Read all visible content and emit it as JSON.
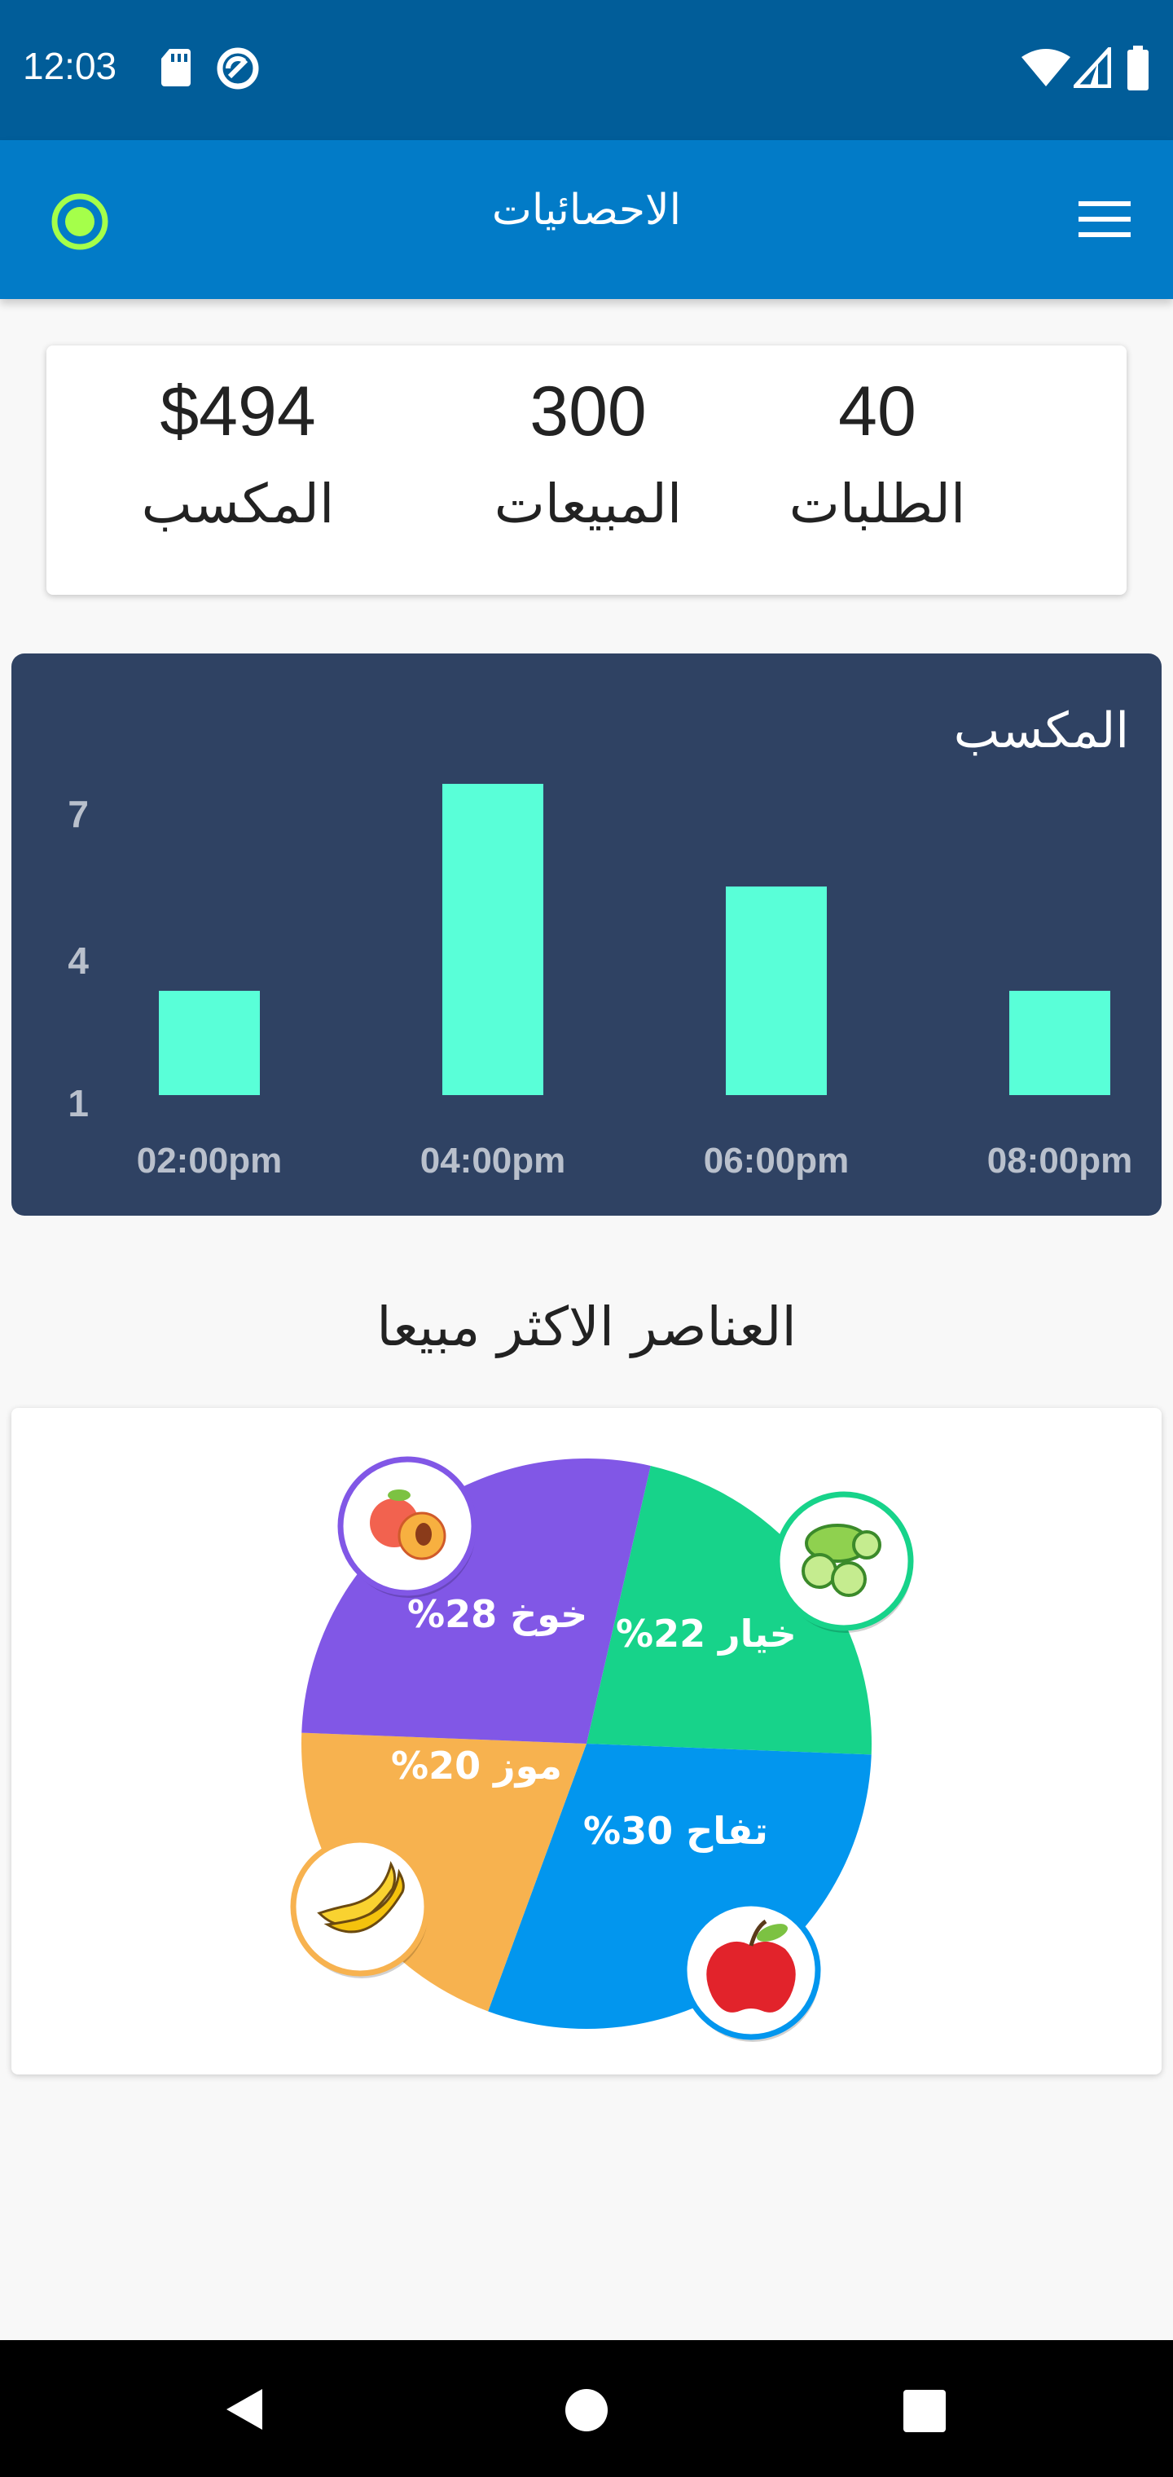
{
  "status_bar": {
    "time": "12:03",
    "icons": [
      "sd-card-icon",
      "do-not-disturb-icon",
      "wifi-icon",
      "signal-icon",
      "battery-icon"
    ]
  },
  "app_bar": {
    "title": "الاحصائيات",
    "left_icon": "record-icon",
    "right_icon": "hamburger-menu-icon"
  },
  "stats": {
    "orders": {
      "value": "40",
      "label": "الطلبات"
    },
    "sales": {
      "value": "300",
      "label": "المبيعات"
    },
    "earnings": {
      "value": "$494",
      "label": "المكسب"
    }
  },
  "earnings_chart": {
    "title": "المكسب"
  },
  "chart_data": [
    {
      "type": "bar",
      "title": "المكسب",
      "categories": [
        "02:00pm",
        "04:00pm",
        "06:00pm",
        "08:00pm"
      ],
      "values": [
        2,
        7,
        5,
        2
      ],
      "y_ticks": [
        "1",
        "4",
        "7"
      ],
      "ylim": [
        0,
        7
      ],
      "grid": false,
      "colors": {
        "bar": "#59ffd8",
        "background": "#2f4263",
        "tick": "#b9c0cc"
      }
    },
    {
      "type": "pie",
      "title": "العناصر الاكثر مبيعا",
      "slices": [
        {
          "label": "خيار",
          "value": 22,
          "text": "خيار 22%",
          "color": "#17d38a",
          "icon": "cucumber-icon"
        },
        {
          "label": "تفاح",
          "value": 30,
          "text": "تفاح 30%",
          "color": "#0296ee",
          "icon": "apple-icon"
        },
        {
          "label": "موز",
          "value": 20,
          "text": "موز 20%",
          "color": "#f7b24f",
          "icon": "banana-icon"
        },
        {
          "label": "خوخ",
          "value": 28,
          "text": "خوخ 28%",
          "color": "#8157e6",
          "icon": "peach-icon"
        }
      ]
    }
  ],
  "top_items": {
    "title": "العناصر الاكثر مبيعا"
  },
  "nav_bar": {
    "icons": [
      "back-icon",
      "home-icon",
      "recents-icon"
    ]
  },
  "colors": {
    "status_bar": "#015d99",
    "app_bar": "#027bc7",
    "record_icon": "#a5ff4a"
  }
}
